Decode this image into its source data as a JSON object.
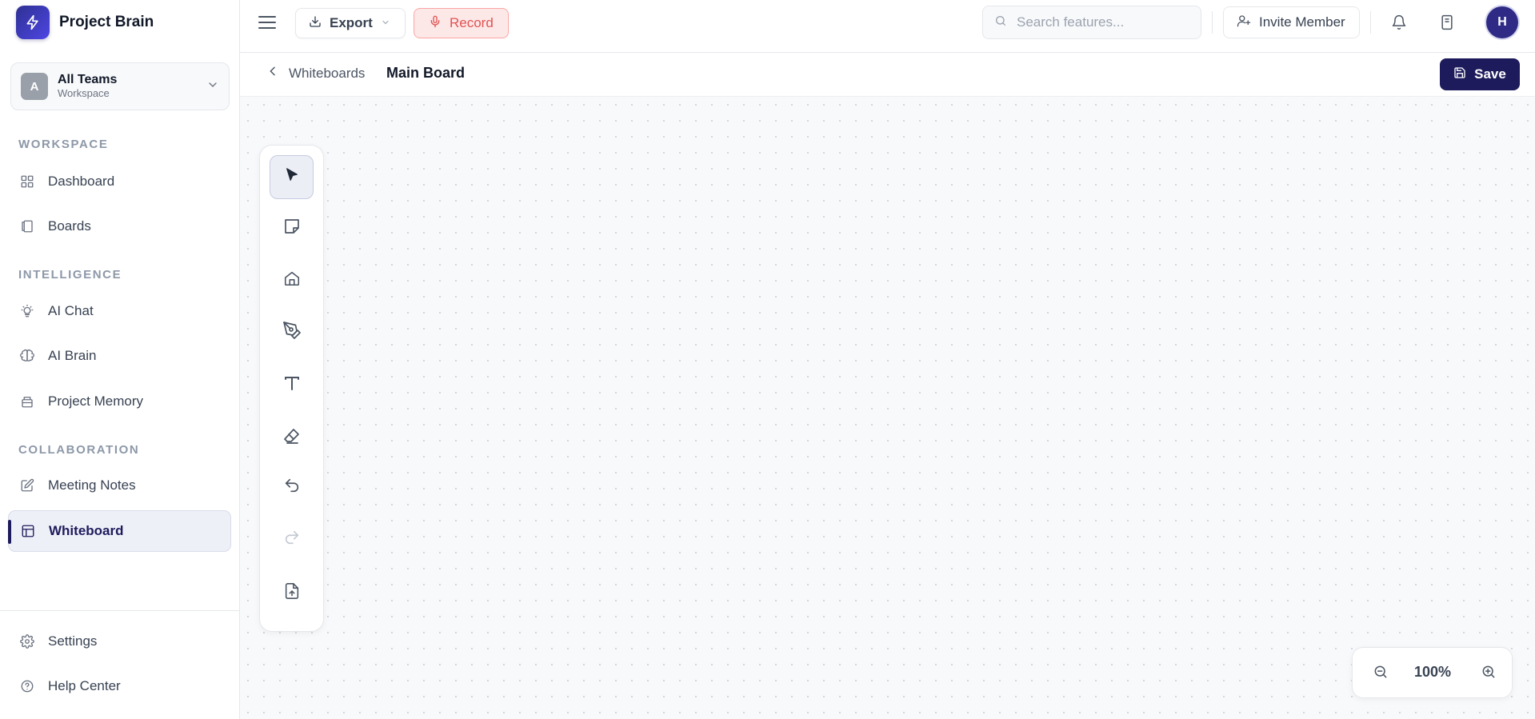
{
  "app": {
    "name": "Project Brain",
    "accent": "#1e1b5c"
  },
  "workspace_selector": {
    "avatar_letter": "A",
    "name": "All Teams",
    "subtitle": "Workspace"
  },
  "sidebar": {
    "sections": {
      "workspace": "WORKSPACE",
      "intelligence": "INTELLIGENCE",
      "collaboration": "COLLABORATION"
    },
    "items": {
      "dashboard": {
        "label": "Dashboard",
        "icon": "grid-icon"
      },
      "boards": {
        "label": "Boards",
        "icon": "book-icon"
      },
      "ai_chat": {
        "label": "AI Chat",
        "icon": "lightbulb-icon"
      },
      "ai_brain": {
        "label": "AI Brain",
        "icon": "brain-icon"
      },
      "project_memory": {
        "label": "Project Memory",
        "icon": "archive-icon"
      },
      "meeting_notes": {
        "label": "Meeting Notes",
        "icon": "edit-icon"
      },
      "whiteboard": {
        "label": "Whiteboard",
        "icon": "layout-icon",
        "active": true
      }
    },
    "footer": {
      "settings": "Settings",
      "help": "Help Center"
    }
  },
  "header": {
    "export_label": "Export",
    "record_label": "Record",
    "search_placeholder": "Search features...",
    "invite_label": "Invite Member",
    "avatar_letter": "H"
  },
  "breadcrumb": {
    "back_label": "Whiteboards",
    "title": "Main Board"
  },
  "save_label": "Save",
  "tools": [
    {
      "name": "select",
      "icon": "cursor-icon",
      "active": true
    },
    {
      "name": "sticky-note",
      "icon": "sticky-note-icon"
    },
    {
      "name": "shape",
      "icon": "home-icon"
    },
    {
      "name": "pen",
      "icon": "pen-tool-icon"
    },
    {
      "name": "text",
      "icon": "text-icon"
    },
    {
      "name": "eraser",
      "icon": "eraser-icon"
    },
    {
      "name": "undo",
      "icon": "undo-icon"
    },
    {
      "name": "redo",
      "icon": "redo-icon",
      "disabled": true
    },
    {
      "name": "upload",
      "icon": "file-upload-icon"
    }
  ],
  "zoom": {
    "level": "100%"
  }
}
